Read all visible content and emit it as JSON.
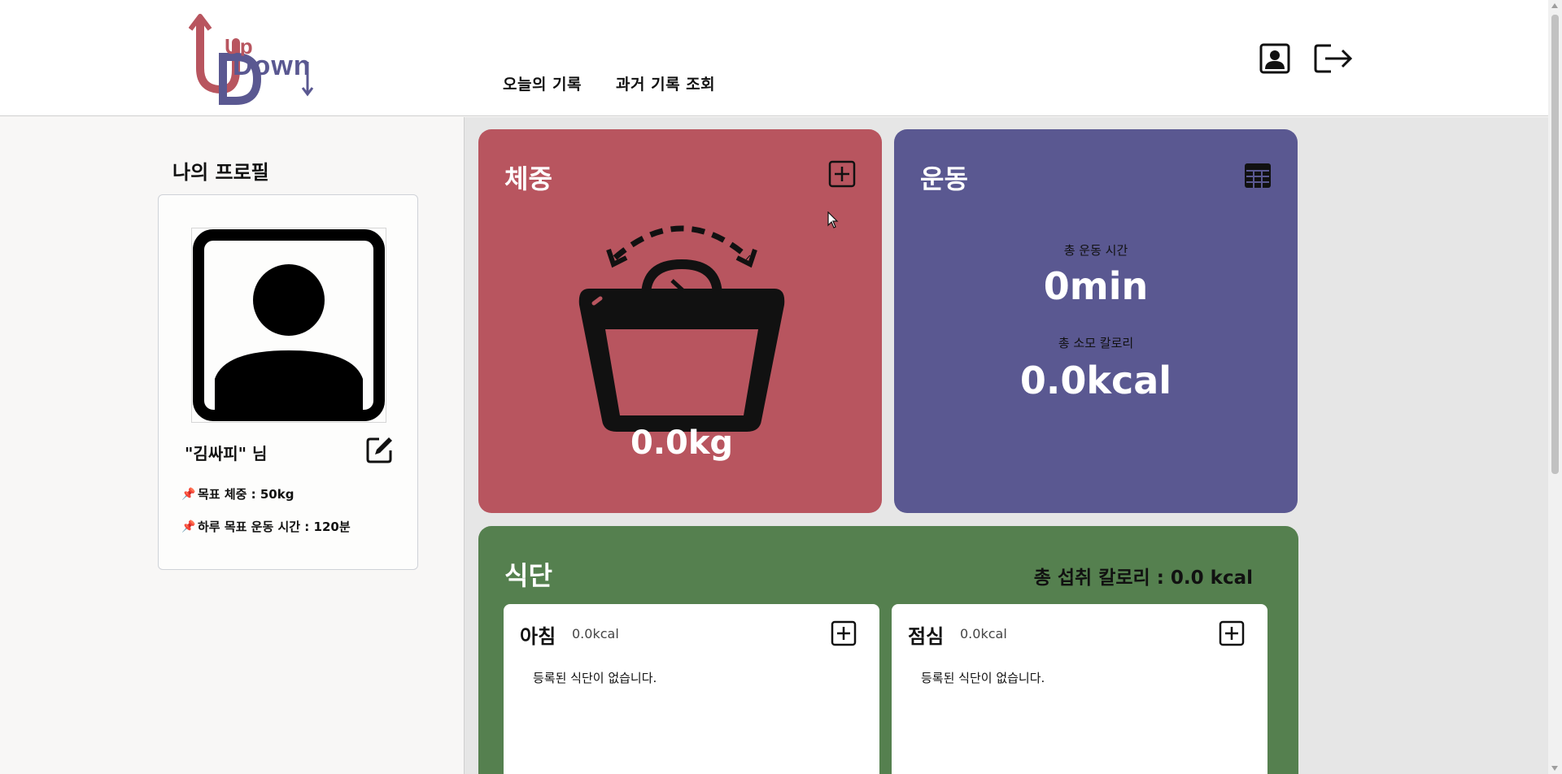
{
  "header": {
    "logo_text_top": "Up",
    "logo_text_bottom": "Down",
    "nav": [
      {
        "label": "오늘의 기록"
      },
      {
        "label": "과거 기록 조회"
      }
    ],
    "icons": [
      "profile-icon",
      "logout-icon"
    ]
  },
  "profile": {
    "title": "나의 프로필",
    "name": "\"김싸피\" 님",
    "goals": [
      {
        "label": "목표 체중 : 50kg"
      },
      {
        "label": "하루 목표 운동 시간 : 120분"
      }
    ]
  },
  "weight": {
    "title": "체중",
    "value": "0.0kg"
  },
  "exercise": {
    "title": "운동",
    "time_label": "총 운동 시간",
    "time_value": "0min",
    "calorie_label": "총 소모 칼로리",
    "calorie_value": "0.0kcal"
  },
  "diet": {
    "title": "식단",
    "total": "총 섭취 칼로리 : 0.0 kcal",
    "meals": [
      {
        "name": "아침",
        "kcal": "0.0kcal",
        "empty": "등록된 식단이 없습니다."
      },
      {
        "name": "점심",
        "kcal": "0.0kcal",
        "empty": "등록된 식단이 없습니다."
      }
    ]
  },
  "colors": {
    "weight": "#b8555f",
    "exercise": "#5a5891",
    "diet": "#55804f",
    "logo_red": "#b8555f",
    "logo_blue": "#5a5891"
  }
}
